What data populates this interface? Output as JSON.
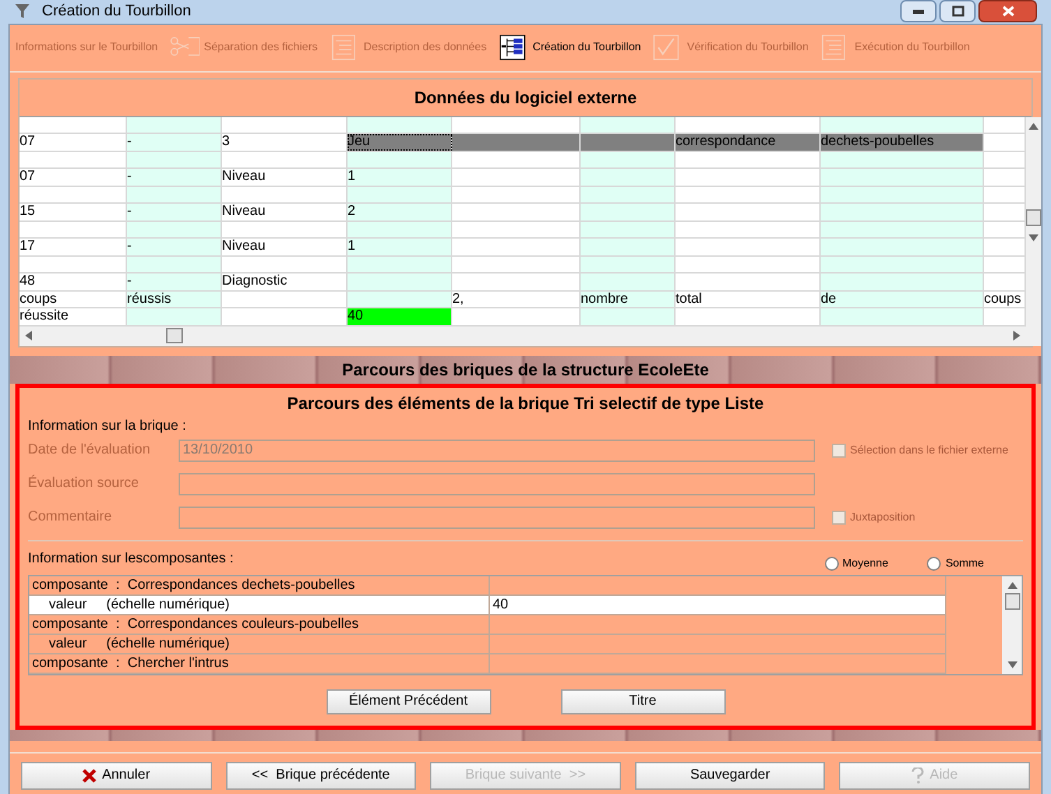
{
  "window": {
    "title": "Création du Tourbillon"
  },
  "toolbar": [
    {
      "label": "Informations sur le Tourbillon",
      "disabled": true
    },
    {
      "label": "Séparation des fichiers",
      "disabled": true
    },
    {
      "label": "Description des données",
      "disabled": true
    },
    {
      "label": "Création du Tourbillon",
      "disabled": false
    },
    {
      "label": "Vérification du Tourbillon",
      "disabled": true
    },
    {
      "label": "Exécution du Tourbillon",
      "disabled": true
    }
  ],
  "external_data": {
    "title": "Données du logiciel externe",
    "rows": [
      [
        {
          "selected": false
        },
        {
          "selected": false
        },
        {
          "selected": false
        },
        {
          "selected": false
        },
        {
          "selected": false
        },
        {
          "selected": false
        },
        {
          "selected": false
        },
        {
          "selected": false
        },
        {
          "selected": false
        }
      ],
      [
        {
          "text": "07",
          "selected": false
        },
        {
          "text": "-",
          "selected": false
        },
        {
          "text": "3",
          "selected": false
        },
        {
          "text": "Jeu",
          "selected": true
        },
        {
          "selected": true
        },
        {
          "selected": true
        },
        {
          "text": "correspondance",
          "selected": true
        },
        {
          "text": "dechets-poubelles",
          "selected": true
        },
        {
          "selected": false
        }
      ],
      [
        {
          "selected": false
        },
        {
          "selected": false
        },
        {
          "selected": false
        },
        {
          "selected": false
        },
        {
          "selected": false
        },
        {
          "selected": false
        },
        {
          "selected": false
        },
        {
          "selected": false
        },
        {
          "selected": false
        }
      ],
      [
        {
          "text": "07",
          "selected": false
        },
        {
          "text": "-",
          "selected": false
        },
        {
          "text": "Niveau",
          "selected": false
        },
        {
          "text": "1",
          "selected": false
        },
        {
          "selected": false
        },
        {
          "selected": false
        },
        {
          "selected": false
        },
        {
          "selected": false
        },
        {
          "selected": false
        }
      ],
      [
        {
          "selected": false
        },
        {
          "selected": false
        },
        {
          "selected": false
        },
        {
          "selected": false
        },
        {
          "selected": false
        },
        {
          "selected": false
        },
        {
          "selected": false
        },
        {
          "selected": false
        },
        {
          "selected": false
        }
      ],
      [
        {
          "text": "15",
          "selected": false
        },
        {
          "text": "-",
          "selected": false
        },
        {
          "text": "Niveau",
          "selected": false
        },
        {
          "text": "2",
          "selected": false
        },
        {
          "selected": false
        },
        {
          "selected": false
        },
        {
          "selected": false
        },
        {
          "selected": false
        },
        {
          "selected": false
        }
      ],
      [
        {
          "selected": false
        },
        {
          "selected": false
        },
        {
          "selected": false
        },
        {
          "selected": false
        },
        {
          "selected": false
        },
        {
          "selected": false
        },
        {
          "selected": false
        },
        {
          "selected": false
        },
        {
          "selected": false
        }
      ],
      [
        {
          "text": "17",
          "selected": false
        },
        {
          "text": "-",
          "selected": false
        },
        {
          "text": "Niveau",
          "selected": false
        },
        {
          "text": "1",
          "selected": false
        },
        {
          "selected": false
        },
        {
          "selected": false
        },
        {
          "selected": false
        },
        {
          "selected": false
        },
        {
          "selected": false
        }
      ],
      [
        {
          "selected": false
        },
        {
          "selected": false
        },
        {
          "selected": false
        },
        {
          "selected": false
        },
        {
          "selected": false
        },
        {
          "selected": false
        },
        {
          "selected": false
        },
        {
          "selected": false
        },
        {
          "selected": false
        }
      ],
      [
        {
          "text": "48",
          "selected": false
        },
        {
          "text": "-",
          "selected": false
        },
        {
          "text": "Diagnostic",
          "selected": false
        },
        {
          "selected": false
        },
        {
          "selected": false
        },
        {
          "selected": false
        },
        {
          "selected": false
        },
        {
          "selected": false
        },
        {
          "selected": false
        }
      ],
      [
        {
          "text": "coups",
          "selected": false
        },
        {
          "text": "réussis",
          "selected": false
        },
        {
          "selected": false
        },
        {
          "selected": false
        },
        {
          "text": "2,",
          "selected": false
        },
        {
          "text": "nombre",
          "selected": false
        },
        {
          "text": "total",
          "selected": false
        },
        {
          "text": "de",
          "selected": false
        },
        {
          "text": "coups",
          "selected": false
        }
      ],
      [
        {
          "text": "réussite",
          "selected": false
        },
        {
          "selected": false
        },
        {
          "selected": false
        },
        {
          "text": "40",
          "selected": false,
          "color": "#00ff00"
        },
        {
          "selected": false
        },
        {
          "selected": false
        },
        {
          "selected": false
        },
        {
          "selected": false
        },
        {
          "selected": false
        }
      ]
    ]
  },
  "structure": {
    "title": "Parcours des briques de la structure EcoleEte"
  },
  "brick": {
    "title": "Parcours des éléments de la brique Tri selectif de type Liste",
    "info_label": "Information sur la brique :",
    "fields": [
      {
        "label": "Date de l'évaluation",
        "value": "13/10/2010",
        "disabled": true,
        "checkbox": {
          "label": "Sélection dans le fichier externe",
          "checked": false,
          "disabled": true
        }
      },
      {
        "label": "Évaluation source",
        "disabled": true
      },
      {
        "label": "Commentaire",
        "disabled": true,
        "checkbox": {
          "label": "Juxtaposition",
          "checked": false,
          "disabled": true
        }
      }
    ],
    "components_label": "Information sur lescomposantes :",
    "modes": [
      {
        "label": "Moyenne",
        "selected": false
      },
      {
        "label": "Somme",
        "selected": false
      }
    ],
    "components": [
      {
        "kind": "component",
        "label": "composante  :  Correspondances dechets-poubelles",
        "selected": false
      },
      {
        "kind": "value",
        "label": "valeur     (échelle numérique)",
        "value": "40",
        "selected": true
      },
      {
        "kind": "component",
        "label": "composante  :  Correspondances couleurs-poubelles",
        "selected": false
      },
      {
        "kind": "value",
        "label": "valeur     (échelle numérique)",
        "selected": false
      },
      {
        "kind": "component",
        "label": "composante  :  Chercher l'intrus",
        "selected": false
      }
    ],
    "buttons": [
      "Élément Précédent",
      "Titre"
    ]
  },
  "footer": [
    {
      "label": "Annuler",
      "disabled": false
    },
    {
      "label": "<<  Brique précédente",
      "disabled": false
    },
    {
      "label": "Brique suivante  >>",
      "disabled": true
    },
    {
      "label": "Sauvegarder",
      "disabled": false
    },
    {
      "label": "Aide",
      "disabled": true
    }
  ]
}
